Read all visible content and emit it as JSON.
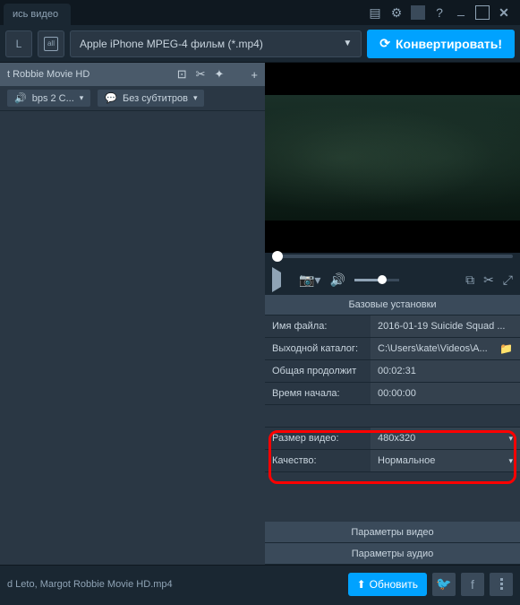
{
  "tab": {
    "title": "ись видео"
  },
  "toolbar": {
    "mode_label": "L",
    "format": "Apple iPhone MPEG-4 фильм (*.mp4)",
    "convert": "Конвертировать!"
  },
  "file": {
    "title": "t Robbie Movie HD",
    "audio_chip": "bps 2 С...",
    "subtitle_chip": "Без субтитров"
  },
  "settings": {
    "header": "Базовые установки",
    "rows": {
      "filename": {
        "label": "Имя файла:",
        "value": "2016-01-19 Suicide Squad ..."
      },
      "outdir": {
        "label": "Выходной каталог:",
        "value": "C:\\Users\\kate\\Videos\\A..."
      },
      "duration": {
        "label": "Общая продолжит",
        "value": "00:02:31"
      },
      "start": {
        "label": "Время начала:",
        "value": "00:00:00"
      },
      "size": {
        "label": "Размер видео:",
        "value": "480x320"
      },
      "quality": {
        "label": "Качество:",
        "value": "Нормальное"
      }
    },
    "video_params": "Параметры видео",
    "audio_params": "Параметры аудио"
  },
  "status": {
    "filename": "d Leto, Margot Robbie Movie HD.mp4",
    "refresh": "Обновить"
  }
}
